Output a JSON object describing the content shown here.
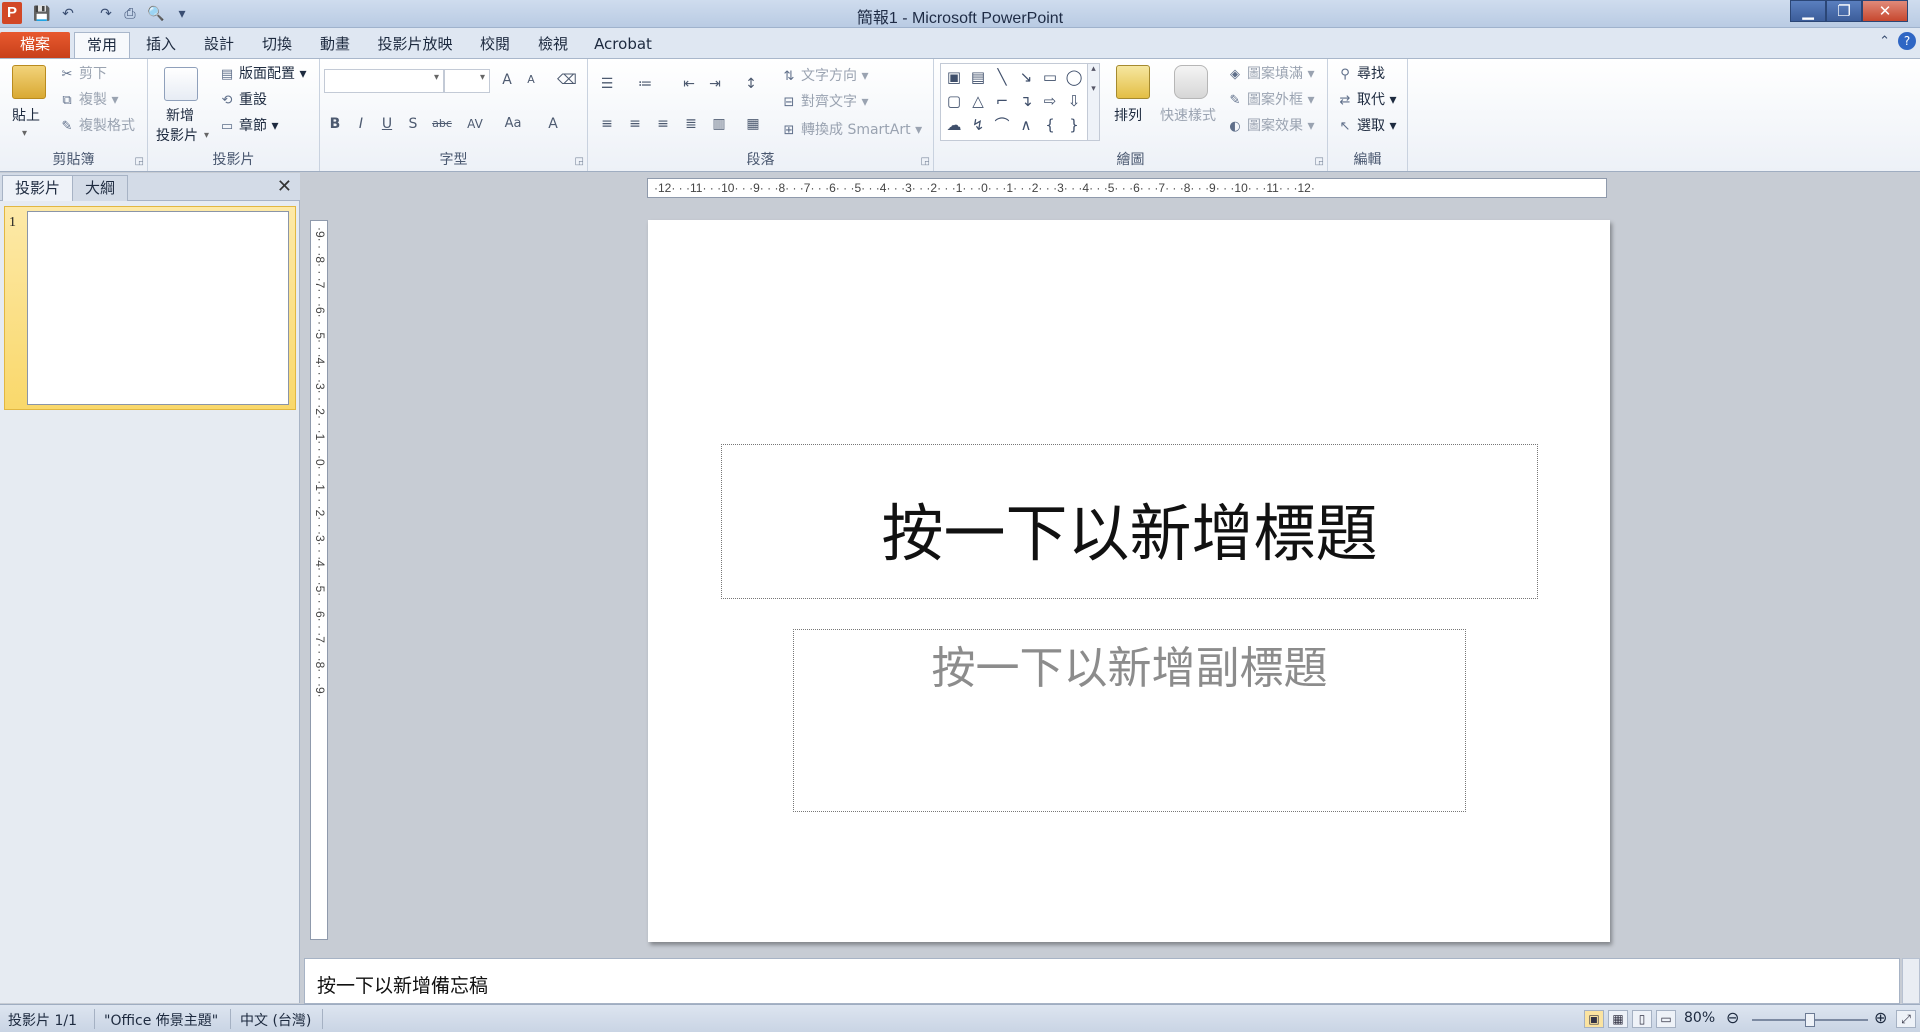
{
  "window": {
    "title": "簡報1 - Microsoft PowerPoint",
    "app_logo": "P",
    "minimize": "▁",
    "maximize": "❐",
    "close": "✕"
  },
  "qat": {
    "save": "💾",
    "undo": "↶",
    "redo": "↷",
    "print": "⎙",
    "preview": "🔍",
    "customize": "▾"
  },
  "tabs": [
    {
      "label": "檔案"
    },
    {
      "label": "常用"
    },
    {
      "label": "插入"
    },
    {
      "label": "設計"
    },
    {
      "label": "切換"
    },
    {
      "label": "動畫"
    },
    {
      "label": "投影片放映"
    },
    {
      "label": "校閱"
    },
    {
      "label": "檢視"
    },
    {
      "label": "Acrobat"
    }
  ],
  "ribbon": {
    "clipboard": {
      "label": "剪貼簿",
      "paste": "貼上",
      "cut": "剪下",
      "copy": "複製",
      "format_painter": "複製格式"
    },
    "slides": {
      "label": "投影片",
      "new_slide_1": "新增",
      "new_slide_2": "投影片",
      "layout": "版面配置",
      "reset": "重設",
      "section": "章節"
    },
    "font": {
      "label": "字型",
      "grow": "A",
      "shrink": "A",
      "clear": "⌫",
      "bold": "B",
      "italic": "I",
      "underline": "U",
      "shadow": "S",
      "strike": "abc",
      "spacing": "AV",
      "case": "Aa",
      "color": "A"
    },
    "paragraph": {
      "label": "段落",
      "text_direction": "文字方向",
      "align_text": "對齊文字",
      "smartart": "轉換成 SmartArt"
    },
    "drawing": {
      "label": "繪圖",
      "arrange": "排列",
      "quick_styles": "快速樣式",
      "fill": "圖案填滿",
      "outline": "圖案外框",
      "effects": "圖案效果"
    },
    "editing": {
      "label": "編輯",
      "find": "尋找",
      "replace": "取代",
      "select": "選取"
    }
  },
  "pane": {
    "tab_slides": "投影片",
    "tab_outline": "大綱",
    "close": "✕",
    "slide_number": "1"
  },
  "ruler": {
    "h": "·12· · ·11· · ·10· · ·9· · ·8· · ·7· · ·6· · ·5· · ·4· · ·3· · ·2· · ·1· · ·0· · ·1· · ·2· · ·3· · ·4· · ·5· · ·6· · ·7· · ·8· · ·9· · ·10· · ·11· · ·12·",
    "v": "·9· · ·8· · ·7· · ·6· · ·5· · ·4· · ·3· · ·2· · ·1· · ·0· · ·1· · ·2· · ·3· · ·4· · ·5· · ·6· · ·7· · ·8· · ·9·"
  },
  "slide": {
    "title_placeholder": "按一下以新增標題",
    "subtitle_placeholder": "按一下以新增副標題"
  },
  "notes": {
    "placeholder": "按一下以新增備忘稿"
  },
  "status": {
    "slide_count": "投影片 1/1",
    "theme": "\"Office 佈景主題\"",
    "language": "中文 (台灣)",
    "zoom": "80%",
    "zoom_level": 0.5
  },
  "colors": {
    "file_tab": "#d24726",
    "accent": "#2f66c4"
  }
}
